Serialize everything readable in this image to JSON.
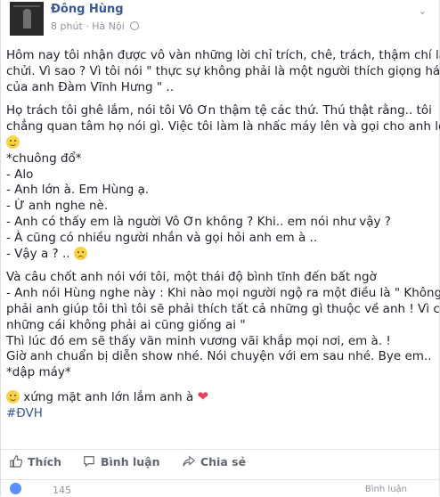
{
  "post": {
    "author": "Đông Hùng",
    "time": "8 phút",
    "separator": "·",
    "location": "Hà Nội",
    "menu_icon": "chevron-down-icon",
    "paragraphs": [
      [
        "Hôm nay tôi nhận được vô vàn những lời chỉ trích, chê, trách, thậm chí là",
        "chửi. Vì sao ? Vì tôi nói \" thực sự không phải là một người thích giọng hát",
        "của anh Đàm Vĩnh Hưng \" .."
      ],
      [
        "Họ trách tôi ghê lắm, nói tôi Vô Ơn thậm tệ các thứ. Thú thật rằng.. tôi",
        "chẳng quan tâm họ nói gì. Việc tôi làm là nhấc máy lên và gọi cho anh lớn"
      ],
      [
        "*chuông đổ*",
        "- Alo",
        "- Anh lớn à. Em Hùng ạ.",
        "- Ừ anh nghe nè.",
        "- Anh có thấy em là người Vô Ơn không ? Khi.. em nói như vậy ?",
        "- À cũng có nhiều người nhắn và gọi hỏi anh em à ..",
        "- Vậy a ? .."
      ],
      [
        "Và câu chốt anh nói với tôi, một thái độ bình tĩnh đến bất ngờ",
        "- Anh nói Hùng nghe này : Khi nào mọi người ngộ ra một điều là \" Không",
        "phải anh giúp tôi thì tôi sẽ phải thích tất cả những gì thuộc về anh ! Vì có",
        "những cái không phải ai cũng giống ai \"",
        "Thì lúc đó em sẽ thấy văn minh vương vãi khắp mọi nơi, em à. !",
        "Giờ anh chuẩn bị diễn show nhé. Nói chuyện với em sau nhé. Bye em..",
        "*dập máy*"
      ]
    ],
    "closing_line": "xứng mặt anh lớn lắm anh à",
    "hashtag": "#ĐVH",
    "emoji_smile": "smile-emoji-icon",
    "emoji_sad": "sad-emoji-icon",
    "heart": "❤"
  },
  "actions": {
    "like": "Thích",
    "comment": "Bình luận",
    "share": "Chia sẻ"
  },
  "footer": {
    "count": "145",
    "comments": "Bình luận"
  },
  "colors": {
    "link": "#365899",
    "text": "#1d2129",
    "meta": "#90949c",
    "action": "#606770",
    "heart": "#e8425a"
  }
}
